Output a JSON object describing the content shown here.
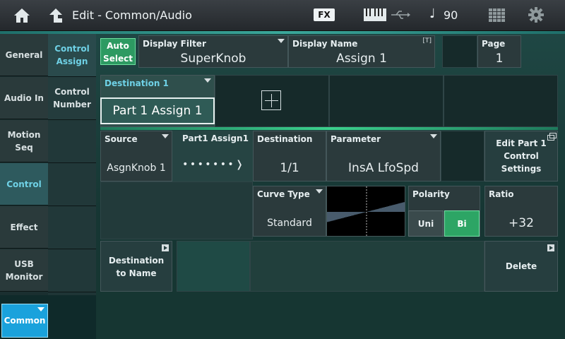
{
  "header": {
    "title": "Edit - Common/Audio",
    "fx_label": "FX",
    "note_glyph": "♩",
    "tempo": "90",
    "icons": [
      "home-icon",
      "up-arrow-icon",
      "keyboard-icon",
      "usb-icon",
      "grid-icon",
      "gear-icon"
    ]
  },
  "nav_primary": [
    {
      "label": "General",
      "active": false
    },
    {
      "label": "Audio In",
      "active": false
    },
    {
      "label": "Motion\nSeq",
      "active": false
    },
    {
      "label": "Control",
      "active": true
    },
    {
      "label": "Effect",
      "active": false
    },
    {
      "label": "USB\nMonitor",
      "active": false
    }
  ],
  "nav_secondary": [
    {
      "label": "Control\nAssign",
      "active": true
    },
    {
      "label": "Control\nNumber",
      "active": false
    }
  ],
  "common_button": "Common",
  "top_row": {
    "auto_select": "Auto\nSelect",
    "display_filter_label": "Display Filter",
    "display_filter_value": "SuperKnob",
    "display_name_label": "Display Name",
    "display_name_value": "Assign 1",
    "display_name_badge": "[T]",
    "page_label": "Page",
    "page_value": "1"
  },
  "destination_row": {
    "label": "Destination 1",
    "value": "Part 1 Assign 1"
  },
  "assign_row": {
    "source_label": "Source",
    "source_value": "AsgnKnob 1",
    "part_assign_label": "Part1 Assign1",
    "dots": "• • • • • • • ❭",
    "destination_label": "Destination",
    "destination_value": "1/1",
    "parameter_label": "Parameter",
    "parameter_value": "InsA LfoSpd",
    "edit_part_label": "Edit Part 1\nControl\nSettings"
  },
  "curve_row": {
    "curve_type_label": "Curve Type",
    "curve_type_value": "Standard",
    "polarity_label": "Polarity",
    "polarity_uni": "Uni",
    "polarity_bi": "Bi",
    "ratio_label": "Ratio",
    "ratio_value": "+32"
  },
  "bottom_row": {
    "dest_to_name": "Destination\nto Name",
    "delete": "Delete"
  }
}
